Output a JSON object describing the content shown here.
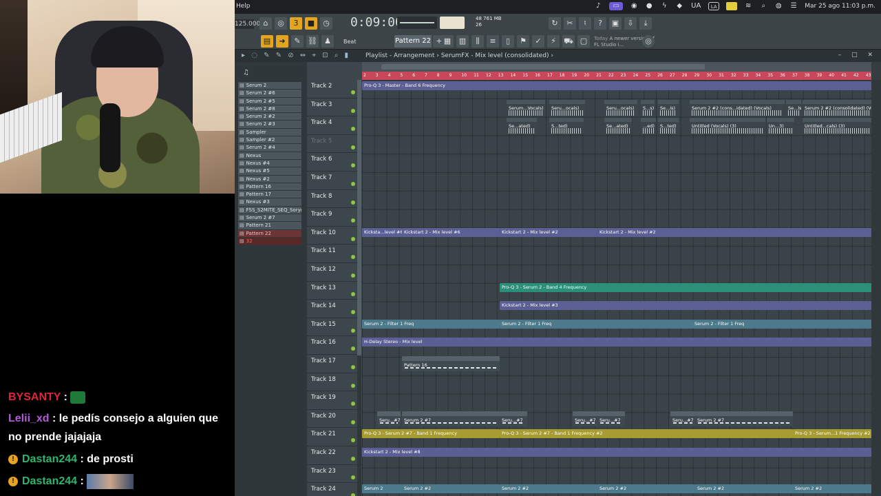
{
  "chat": {
    "messages": [
      {
        "user": "BYSANTY",
        "text": "",
        "color": "#e0243a",
        "badge": false,
        "emote": "green-emote"
      },
      {
        "user": "Lelii_xd",
        "text": "le pedís consejo a alguien que no prende jajajaja",
        "color": "#b25bd4",
        "badge": false
      },
      {
        "user": "Dastan244",
        "text": "de prosti",
        "color": "#2fb56d",
        "badge": true
      },
      {
        "user": "Dastan244",
        "text": "",
        "color": "#2fb56d",
        "badge": true,
        "emote": "image-emote"
      }
    ]
  },
  "menubar": {
    "help": "Help",
    "lang": "UA",
    "la": "LA",
    "datetime": "Mar 25 ago  11:03 p.m."
  },
  "toolbar": {
    "bpm": "125.000",
    "time": "0:09:00",
    "cpu_top": "48",
    "mem": "761 MB",
    "cpu_bottom": "26",
    "beat_label": "Beat",
    "pattern": "Pattern 22",
    "news_title": "Today",
    "news_text": "A newer version of FL Studio i..."
  },
  "playlist": {
    "title": "Playlist - Arrangement",
    "breadcrumb": "SerumFX - Mix level (consolidated)",
    "ruler": [
      "2",
      "3",
      "4",
      "5",
      "6",
      "7",
      "8",
      "9",
      "10",
      "11",
      "12",
      "13",
      "14",
      "15",
      "16",
      "17",
      "18",
      "19",
      "20",
      "21",
      "22",
      "23",
      "24",
      "25",
      "26",
      "27",
      "28",
      "29",
      "30",
      "31",
      "32",
      "33",
      "34",
      "35",
      "36",
      "37",
      "38",
      "39",
      "40",
      "41",
      "42",
      "43"
    ]
  },
  "picker": [
    "Serum 2",
    "Serum 2 #6",
    "Serum 2 #5",
    "Serum 2 #8",
    "Serum 2 #2",
    "Serum 2 #3",
    "Sampler",
    "Sampler #2",
    "Serum 2 #4",
    "Nexus",
    "Nexus #4",
    "Nexus #5",
    "Nexus #2",
    "Pattern 16",
    "Pattern 17",
    "Nexus #3",
    "FSS_S2MITE_SEQ_Soryn",
    "Serum 2 #7",
    "Pattern 21",
    "Pattern 22",
    "32"
  ],
  "tracks": [
    {
      "name": "Track 2",
      "dim": false
    },
    {
      "name": "Track 3",
      "dim": false
    },
    {
      "name": "Track 4",
      "dim": false
    },
    {
      "name": "Track 5",
      "dim": true
    },
    {
      "name": "Track 6",
      "dim": false
    },
    {
      "name": "Track 7",
      "dim": false
    },
    {
      "name": "Track 8",
      "dim": false
    },
    {
      "name": "Track 9",
      "dim": false
    },
    {
      "name": "Track 10",
      "dim": false
    },
    {
      "name": "Track 11",
      "dim": false
    },
    {
      "name": "Track 12",
      "dim": false
    },
    {
      "name": "Track 13",
      "dim": false
    },
    {
      "name": "Track 14",
      "dim": false
    },
    {
      "name": "Track 15",
      "dim": false
    },
    {
      "name": "Track 16",
      "dim": false
    },
    {
      "name": "Track 17",
      "dim": false
    },
    {
      "name": "Track 18",
      "dim": false
    },
    {
      "name": "Track 19",
      "dim": false
    },
    {
      "name": "Track 20",
      "dim": false
    },
    {
      "name": "Track 21",
      "dim": false
    },
    {
      "name": "Track 22",
      "dim": false
    },
    {
      "name": "Track 23",
      "dim": false
    },
    {
      "name": "Track 24",
      "dim": false
    }
  ],
  "clips": {
    "c1": "Pro-Q 3 - Master - Band 6 Frequency",
    "c2": "Serum...Vocals)",
    "c3": "Seru...ocals)",
    "c4": "Seru...ocals)",
    "c5": "S...s)",
    "c6": "Se...is)",
    "c7": "Serum 2 #2 (cons...idated) (Vocals)",
    "c8": "Se...ls)",
    "c9": "Serum 2 #2 (consolidated) (Vocals)",
    "c10": "Se...ated)",
    "c11": "S...ted)",
    "c12": "Se...ated)",
    "c13": "...ed)",
    "c14": "S...ted)",
    "c15": "Untitled (Vocals) (3)",
    "c16": "Un...3)",
    "c17": "Untitled...cals) (3)",
    "c18": "Kicksta...level #6",
    "c19": "Kickstart 2 - Mix level #6",
    "c20": "Kickstart 2 - Mix level #2",
    "c21": "Kickstart 2 - Mix level #2",
    "c22": "Pro-Q 3 - Serum 2 - Band 4 Frequency",
    "c23": "Kickstart 2 - Mix level #3",
    "c24": "Serum 2 - Filter 1 Freq",
    "c25": "Serum 2 - Filter 1 Freq",
    "c26": "Serum 2 - Filter 1 Freq",
    "c27": "H-Delay Stereo - Mix level",
    "c28": "Pattern 16",
    "c29": "Seru...#7",
    "c30": "Serum 2 #7",
    "c31": "Seru...#7",
    "c32": "Seru...#7",
    "c33": "Seru...#7",
    "c34": "Seru...#7",
    "c35": "Serum 2 #7",
    "c36": "Pro-Q 3 - Serum 2 #7 - Band 1 Frequency",
    "c37": "Pro-Q 3 - Serum 2 #7 - Band 1 Frequency #2",
    "c38": "Pro-Q 3 - Serum...1 Frequency #2",
    "c39": "Kickstart 2 - Mix level #8",
    "c40": "Serum 2",
    "c41": "Serum 2 #2",
    "c42": "Serum 2 #2",
    "c43": "Serum 2 #2",
    "c44": "Serum 2 #2",
    "c45": "Serum 2 #2"
  }
}
